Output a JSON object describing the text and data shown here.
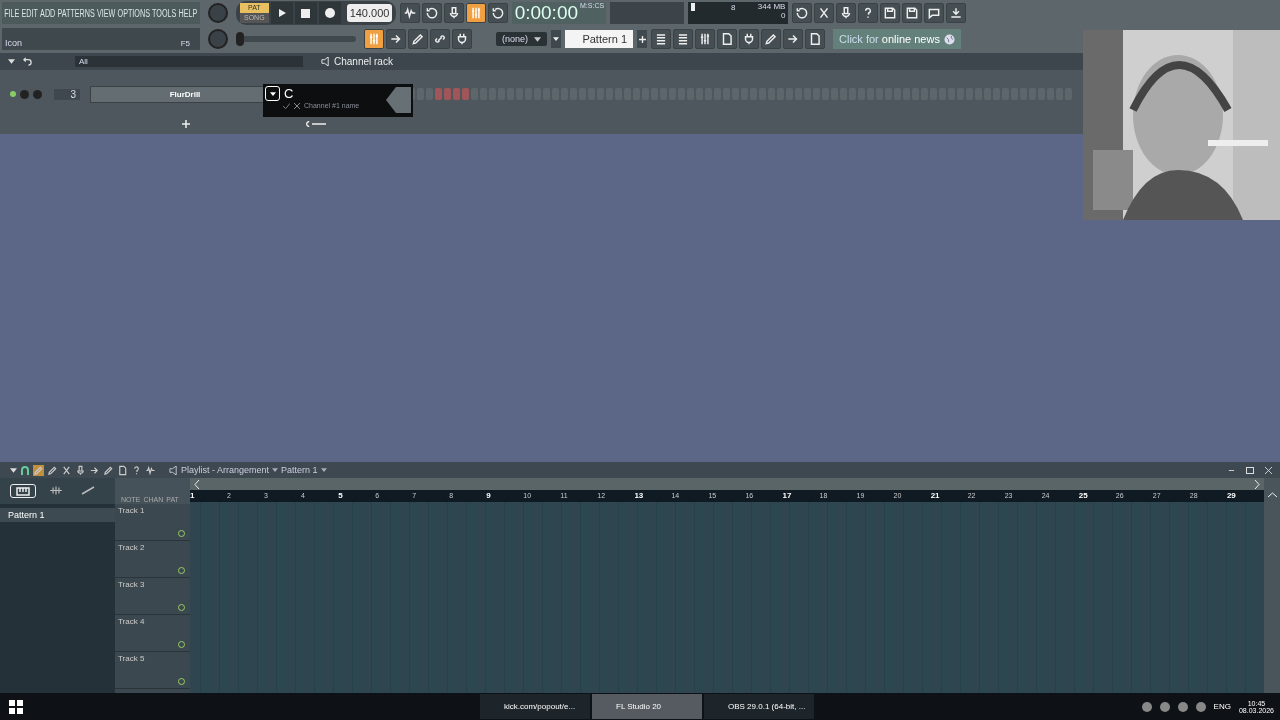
{
  "menu": [
    "FILE",
    "EDIT",
    "ADD",
    "PATTERNS",
    "VIEW",
    "OPTIONS",
    "TOOLS",
    "HELP"
  ],
  "transport": {
    "modes": [
      {
        "label": "PAT",
        "selected": true
      },
      {
        "label": "SONG",
        "selected": false
      }
    ],
    "tempo": "140.000",
    "time": "0:00:00",
    "time_unit": "M:S:CS"
  },
  "record_toggles": [
    {
      "on": false
    },
    {
      "on": false
    },
    {
      "on": false
    },
    {
      "on": true
    },
    {
      "on": false
    }
  ],
  "monitor": {
    "cpu": "8",
    "memory": "344 MB",
    "polyphony": "0"
  },
  "pitch_slider": {
    "level": 0
  },
  "hint_bar": {
    "text": "Icon",
    "shortcut": "F5"
  },
  "snap_toggles": [
    {
      "on": true
    },
    {
      "on": false
    },
    {
      "on": false
    },
    {
      "on": false
    },
    {
      "on": false
    }
  ],
  "pattern_picker": {
    "snap": "(none)",
    "pattern": "Pattern 1"
  },
  "news": {
    "prefix": "Click for",
    "link": "online news"
  },
  "channel_rack": {
    "filter": "All",
    "title": "Channel rack",
    "channel": {
      "number": "3",
      "name": "FlurDrill"
    },
    "rename": {
      "value": "C",
      "hint": "Channel #1 name"
    }
  },
  "playlist": {
    "title": "Playlist - Arrangement",
    "pattern": "Pattern 1",
    "pattern_list": [
      {
        "label": "Pattern 1",
        "selected": true
      }
    ],
    "modes": [
      "NOTE",
      "CHAN",
      "PAT"
    ],
    "tracks": [
      "Track 1",
      "Track 2",
      "Track 3",
      "Track 4",
      "Track 5"
    ],
    "bars": [
      "1",
      "2",
      "3",
      "4",
      "5",
      "6",
      "7",
      "8",
      "9",
      "10",
      "11",
      "12",
      "13",
      "14",
      "15",
      "16",
      "17",
      "18",
      "19",
      "20",
      "21",
      "22",
      "23",
      "24",
      "25",
      "26",
      "27",
      "28",
      "29"
    ]
  },
  "taskbar": {
    "apps": [
      {
        "label": "kick.com/popout/e...",
        "selected": false
      },
      {
        "label": "FL Studio 20",
        "selected": true
      },
      {
        "label": "OBS 29.0.1 (64-bit, ...",
        "selected": false
      }
    ],
    "language": "ENG",
    "time": "10:45",
    "date": "08.03.2026"
  }
}
